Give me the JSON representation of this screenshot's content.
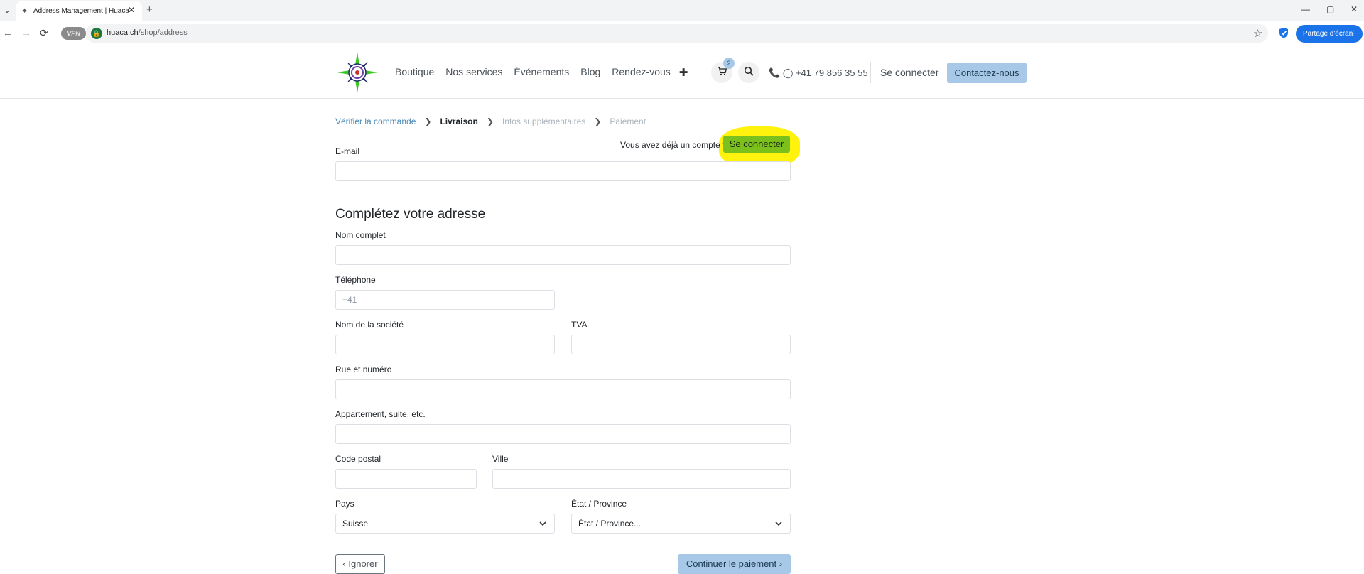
{
  "browser": {
    "tab_title": "Address Management | Huaca",
    "new_tab": "+",
    "close_tab": "✕",
    "url_host": "huaca.ch",
    "url_path": "/shop/address",
    "vpn_label": "VPN",
    "share_label": "Partage d'écran",
    "window_controls": [
      "—",
      "▢",
      "✕"
    ]
  },
  "header": {
    "nav": [
      "Boutique",
      "Nos services",
      "Événements",
      "Blog",
      "Rendez-vous"
    ],
    "nav_more": "✚",
    "cart_count": "2",
    "phone": "+41 79 856 35 55",
    "login": "Se connecter",
    "contact": "Contactez-nous"
  },
  "breadcrumb": {
    "step1": "Vérifier la commande",
    "step2": "Livraison",
    "step3": "Infos supplémentaires",
    "step4": "Paiement"
  },
  "account": {
    "prompt": "Vous avez déjà un compte ?",
    "login_button": "Se connecter"
  },
  "form": {
    "email_label": "E-mail",
    "section_title": "Complétez votre adresse",
    "fullname_label": "Nom complet",
    "phone_label": "Téléphone",
    "phone_placeholder": "+41",
    "company_label": "Nom de la société",
    "vat_label": "TVA",
    "street_label": "Rue et numéro",
    "apartment_label": "Appartement, suite, etc.",
    "zip_label": "Code postal",
    "city_label": "Ville",
    "country_label": "Pays",
    "country_value": "Suisse",
    "state_label": "État / Province",
    "state_value": "État / Province..."
  },
  "actions": {
    "ignore": "Ignorer",
    "continue": "Continuer le paiement"
  },
  "colors": {
    "accent_blue": "#a7c9e7",
    "highlight_yellow": "#fff200",
    "login_green": "#7cc01e",
    "chrome_blue": "#1a73e8"
  }
}
